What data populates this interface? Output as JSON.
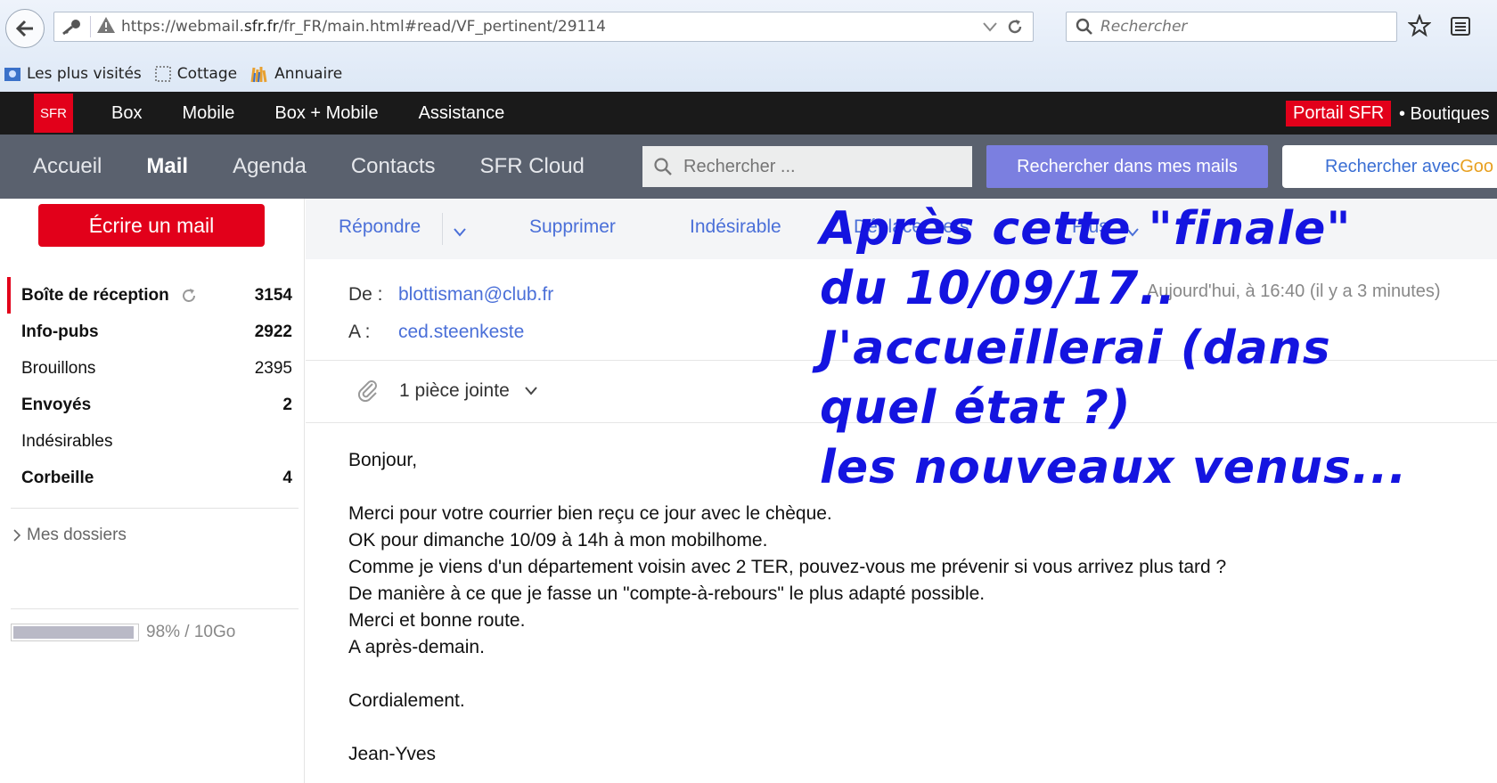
{
  "browser": {
    "url_prefix": "https://webmail.",
    "url_domain": "sfr.fr",
    "url_suffix": "/fr_FR/main.html#read/VF_pertinent/29114",
    "search_placeholder": "Rechercher",
    "bookmarks": [
      "Les plus visités",
      "Cottage",
      "Annuaire"
    ]
  },
  "topbar": {
    "logo": "SFR",
    "nav": [
      "Box",
      "Mobile",
      "Box + Mobile",
      "Assistance"
    ],
    "portail": "Portail SFR",
    "boutiques": "• Boutiques"
  },
  "mailnav": {
    "links": [
      "Accueil",
      "Mail",
      "Agenda",
      "Contacts",
      "SFR Cloud"
    ],
    "active": "Mail",
    "search_placeholder": "Rechercher ...",
    "search_mails_button": "Rechercher dans mes mails",
    "google_button_prefix": "Rechercher avec ",
    "google_button_brand": "Goo"
  },
  "sidebar": {
    "compose": "Écrire un mail",
    "folders": [
      {
        "name": "Boîte de réception",
        "count": "3154",
        "bold": true
      },
      {
        "name": "Info-pubs",
        "count": "2922",
        "bold": true
      },
      {
        "name": "Brouillons",
        "count": "2395",
        "bold": false
      },
      {
        "name": "Envoyés",
        "count": "2",
        "bold": true
      },
      {
        "name": "Indésirables",
        "count": "",
        "bold": false
      },
      {
        "name": "Corbeille",
        "count": "4",
        "bold": true
      }
    ],
    "mes_dossiers": "Mes dossiers",
    "quota_text": "98% / 10Go",
    "quota_fraction": 0.98
  },
  "toolbar": {
    "reply": "Répondre",
    "delete": "Supprimer",
    "spam": "Indésirable",
    "move": "Déplacer vers",
    "more": "Plus"
  },
  "message": {
    "from_label": "De :",
    "from": "blottisman@club.fr",
    "to_label": "A :",
    "to": "ced.steenkeste",
    "date": "Aujourd'hui, à 16:40 (il y a 3 minutes)",
    "attachments": "1 pièce jointe",
    "body": [
      "Bonjour,",
      "",
      "Merci pour votre courrier bien reçu ce jour avec le chèque.",
      "OK pour dimanche 10/09 à 14h à mon mobilhome.",
      "Comme je viens d'un département voisin avec 2 TER, pouvez-vous me prévenir si vous arrivez plus tard ?",
      "De manière à ce que je fasse un \"compte-à-rebours\" le plus adapté possible.",
      "Merci et bonne route.",
      "A après-demain.",
      "",
      "Cordialement.",
      "",
      "Jean-Yves"
    ]
  },
  "overlay": {
    "lines": [
      "Après cette \"finale\"",
      "du 10/09/17..",
      "J'accueillerai (dans",
      "quel état ?)",
      "les nouveaux venus..."
    ]
  },
  "colors": {
    "sfr_red": "#e2001a",
    "link_blue": "#4a6fd8",
    "overlay_blue": "#1414e0",
    "nav_gray": "#5a616e"
  }
}
